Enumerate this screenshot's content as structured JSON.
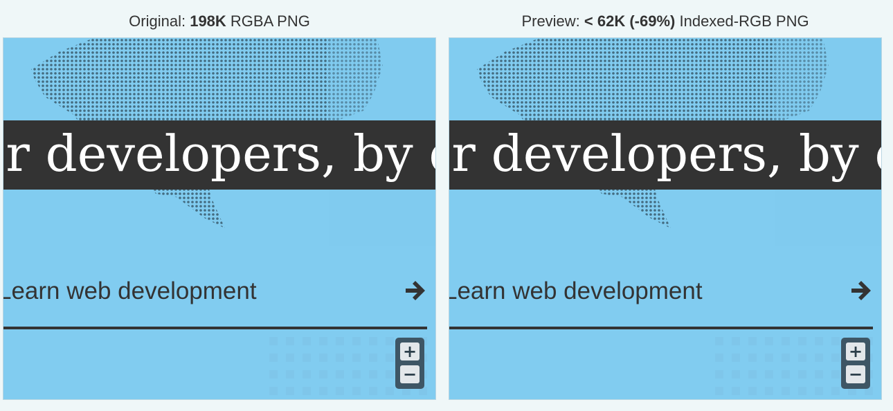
{
  "original": {
    "prefix": "Original: ",
    "size": "198K",
    "suffix": " RGBA PNG",
    "banner_text": "or developers, by d",
    "link_text": "Learn web development"
  },
  "preview": {
    "prefix": "Preview: ",
    "size": "< 62K (-69%)",
    "suffix": " Indexed-RGB PNG",
    "banner_text": "or developers, by d",
    "link_text": "Learn web development"
  },
  "zoom": {
    "in_label": "+",
    "out_label": "−"
  },
  "icons": {
    "arrow": "arrow-right-icon",
    "zoom_in": "plus-icon",
    "zoom_out": "minus-icon"
  },
  "colors": {
    "panel_bg": "#81ccf0",
    "band_bg": "#333333",
    "band_text": "#ffffff",
    "link_text": "#333333",
    "zoom_bg": "#3e5665"
  }
}
